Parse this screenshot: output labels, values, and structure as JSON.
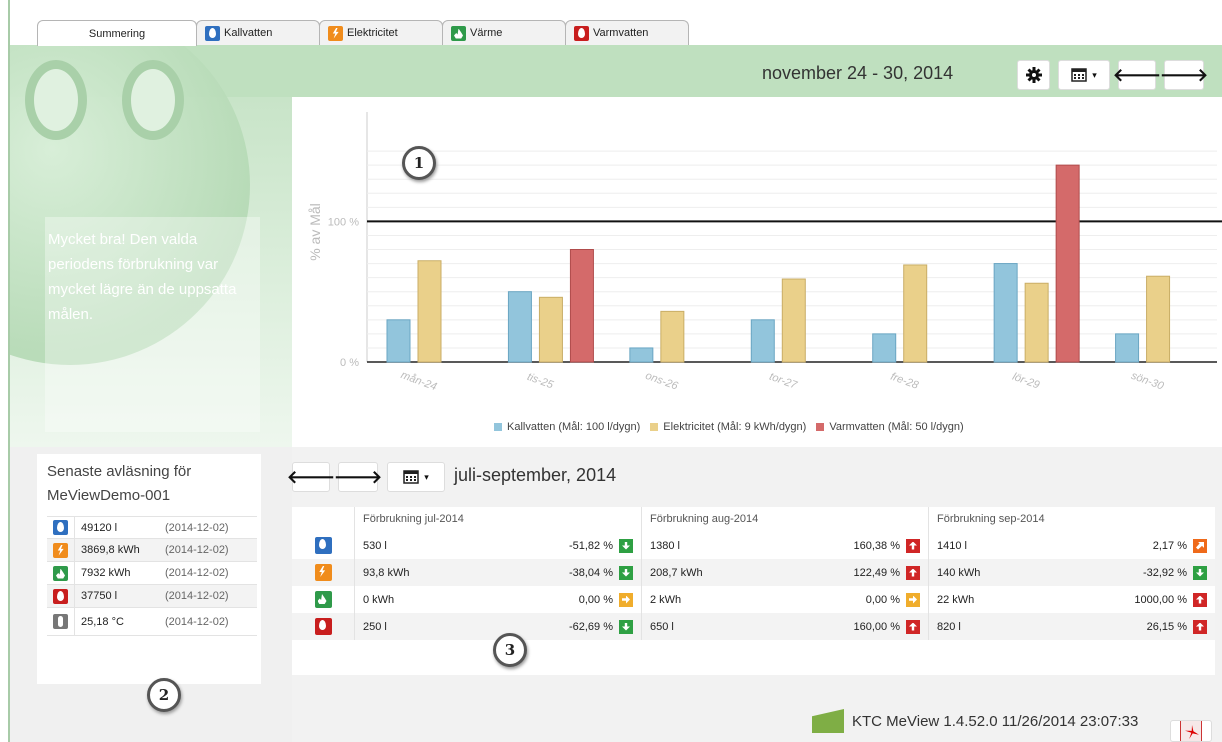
{
  "tabs": [
    {
      "label": "Summering",
      "icon": "",
      "active": true
    },
    {
      "label": "Kallvatten",
      "icon": "water-drop-icon"
    },
    {
      "label": "Elektricitet",
      "icon": "lightning-icon"
    },
    {
      "label": "Värme",
      "icon": "flame-icon"
    },
    {
      "label": "Varmvatten",
      "icon": "hot-water-drop-icon"
    }
  ],
  "header": {
    "period": "november 24 - 30, 2014",
    "settings_icon": "gear-icon",
    "calendar_icon": "calendar-icon",
    "prev_icon": "arrow-left-icon",
    "next_icon": "arrow-right-icon"
  },
  "note": "Mycket bra! Den valda periodens förbrukning var mycket lägre än de uppsatta målen.",
  "colors": {
    "kallvatten": "#92c5dc",
    "elektricitet": "#ead08a",
    "varmvatten": "#d46a6a",
    "band": "#bfe0bf"
  },
  "chart_data": {
    "type": "bar",
    "ylabel": "% av Mål",
    "ylim": [
      0,
      160
    ],
    "yticks": [
      "0 %",
      "100 %"
    ],
    "target_line": 100,
    "categories": [
      "mån-24",
      "tis-25",
      "ons-26",
      "tor-27",
      "fre-28",
      "lör-29",
      "sön-30"
    ],
    "series": [
      {
        "name": "Kallvatten (Mål: 100 l/dygn)",
        "color": "#92c5dc",
        "values": [
          30,
          50,
          10,
          30,
          20,
          70,
          20
        ]
      },
      {
        "name": "Elektricitet (Mål: 9 kWh/dygn)",
        "color": "#ead08a",
        "values": [
          72,
          46,
          36,
          59,
          69,
          56,
          61
        ]
      },
      {
        "name": "Varmvatten (Mål: 50 l/dygn)",
        "color": "#d46a6a",
        "values": [
          null,
          80,
          null,
          null,
          null,
          140,
          null
        ]
      }
    ]
  },
  "readings": {
    "title": "Senaste avläsning för MeViewDemo-001",
    "rows": [
      {
        "icon": "water-drop-icon",
        "value": "49120 l",
        "date": "(2014-12-02)"
      },
      {
        "icon": "lightning-icon",
        "value": "3869,8 kWh",
        "date": "(2014-12-02)"
      },
      {
        "icon": "flame-icon",
        "value": "7932 kWh",
        "date": "(2014-12-02)"
      },
      {
        "icon": "hot-water-drop-icon",
        "value": "37750 l",
        "date": "(2014-12-02)"
      },
      {
        "icon": "thermometer-icon",
        "value": "25,18 °C",
        "date": "(2014-12-02)"
      }
    ]
  },
  "quarter": {
    "title": "juli-september, 2014"
  },
  "table": {
    "headers": [
      "Förbrukning jul-2014",
      "Förbrukning aug-2014",
      "Förbrukning sep-2014"
    ],
    "rows": [
      {
        "icon": "water-drop-icon",
        "cells": [
          {
            "value": "530 l",
            "pct": "-51,82 %",
            "trend": "down"
          },
          {
            "value": "1380 l",
            "pct": "160,38 %",
            "trend": "up"
          },
          {
            "value": "1410 l",
            "pct": "2,17 %",
            "trend": "diag"
          }
        ]
      },
      {
        "icon": "lightning-icon",
        "cells": [
          {
            "value": "93,8 kWh",
            "pct": "-38,04 %",
            "trend": "down"
          },
          {
            "value": "208,7 kWh",
            "pct": "122,49 %",
            "trend": "up"
          },
          {
            "value": "140 kWh",
            "pct": "-32,92 %",
            "trend": "down"
          }
        ]
      },
      {
        "icon": "flame-icon",
        "cells": [
          {
            "value": "0 kWh",
            "pct": "0,00 %",
            "trend": "right"
          },
          {
            "value": "2 kWh",
            "pct": "0,00 %",
            "trend": "right"
          },
          {
            "value": "22 kWh",
            "pct": "1000,00 %",
            "trend": "up"
          }
        ]
      },
      {
        "icon": "hot-water-drop-icon",
        "cells": [
          {
            "value": "250 l",
            "pct": "-62,69 %",
            "trend": "down"
          },
          {
            "value": "650 l",
            "pct": "160,00 %",
            "trend": "up"
          },
          {
            "value": "820 l",
            "pct": "26,15 %",
            "trend": "up"
          }
        ]
      }
    ]
  },
  "callouts": [
    "1",
    "2",
    "3"
  ],
  "footer": {
    "text": "KTC MeView 1.4.52.0 11/26/2014 23:07:33",
    "logo_icon": "ktc-logo-icon",
    "pdf_icon": "pdf-icon"
  }
}
